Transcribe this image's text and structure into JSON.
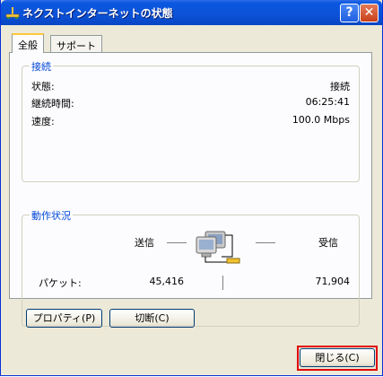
{
  "window": {
    "title": "ネクストインターネットの状態",
    "help_label": "?",
    "close_glyph": "✕"
  },
  "tabs": [
    {
      "label": "全般"
    },
    {
      "label": "サポート"
    }
  ],
  "connection": {
    "group_title": "接続",
    "status_label": "状態:",
    "status_value": "接続",
    "duration_label": "継続時間:",
    "duration_value": "06:25:41",
    "speed_label": "速度:",
    "speed_value": "100.0 Mbps"
  },
  "activity": {
    "group_title": "動作状況",
    "sent_label": "送信",
    "received_label": "受信",
    "packets_label": "パケット:",
    "packets_sent": "45,416",
    "packets_received": "71,904"
  },
  "buttons": {
    "properties": "プロパティ(P)",
    "disable": "切断(C)",
    "close": "閉じる(C)"
  },
  "colors": {
    "titlebar": "#0c52d6",
    "group_title": "#0046d5",
    "focus_highlight": "#e00000"
  }
}
